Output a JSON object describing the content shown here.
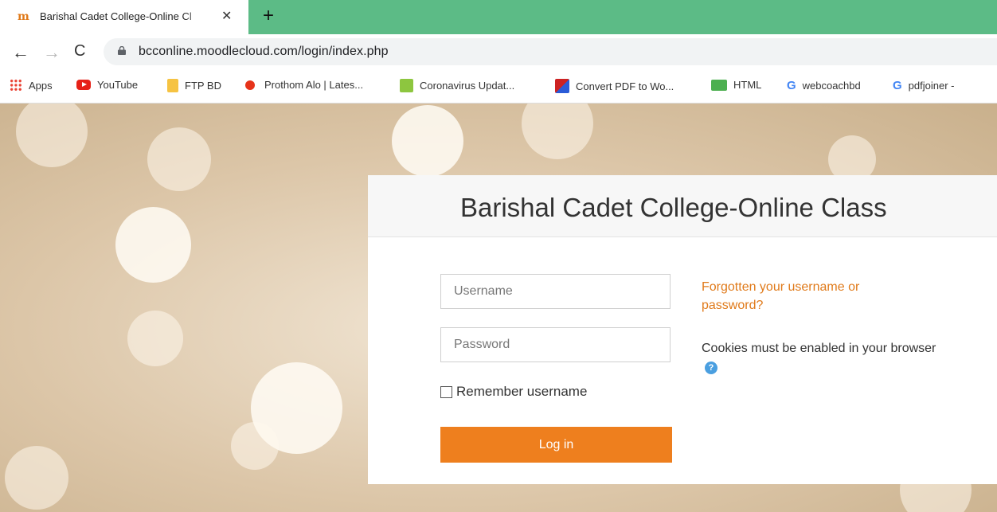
{
  "browser": {
    "tab": {
      "title": "Barishal Cadet College-Online Cl",
      "favicon": "moodle-m-icon",
      "close": "✕"
    },
    "new_tab": "+",
    "nav": {
      "back": "←",
      "forward": "→",
      "reload": "C"
    },
    "url": "bcconline.moodlecloud.com/login/index.php",
    "bookmarks": [
      {
        "label": "Apps",
        "icon": "apps-grid-icon"
      },
      {
        "label": "YouTube",
        "icon": "youtube-icon"
      },
      {
        "label": "FTP BD",
        "icon": "folder-icon"
      },
      {
        "label": "Prothom Alo | Lates...",
        "icon": "prothom-alo-icon"
      },
      {
        "label": "Coronavirus Updat...",
        "icon": "worldometer-icon"
      },
      {
        "label": "Convert PDF to Wo...",
        "icon": "pdf-convert-icon"
      },
      {
        "label": "HTML",
        "icon": "w3schools-icon"
      },
      {
        "label": "webcoachbd",
        "icon": "google-icon"
      },
      {
        "label": "pdfjoiner -",
        "icon": "google-icon"
      }
    ]
  },
  "login": {
    "title": "Barishal Cadet College-Online Class",
    "username_placeholder": "Username",
    "password_placeholder": "Password",
    "remember_label": "Remember username",
    "login_button": "Log in",
    "forgot_link": "Forgotten your username or password?",
    "cookies_text": "Cookies must be enabled in your browser",
    "help_icon": "?"
  },
  "colors": {
    "accent": "#ee7f1e",
    "link": "#e07a1a",
    "tabstrip": "#5cbb86"
  }
}
